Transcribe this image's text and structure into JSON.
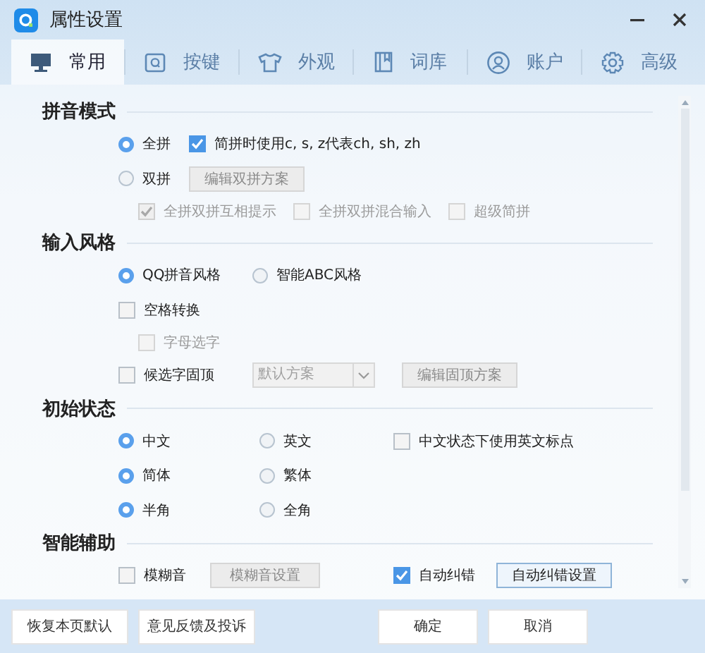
{
  "window": {
    "title": "属性设置"
  },
  "tabs": [
    {
      "label": "常用",
      "selected": true
    },
    {
      "label": "按键",
      "selected": false
    },
    {
      "label": "外观",
      "selected": false
    },
    {
      "label": "词库",
      "selected": false
    },
    {
      "label": "账户",
      "selected": false
    },
    {
      "label": "高级",
      "selected": false
    }
  ],
  "sections": [
    {
      "title": "拼音模式",
      "rows": [
        {
          "kind": "main",
          "items": [
            {
              "kind": "radio",
              "label": "全拼",
              "selected": true,
              "disabled": false
            },
            {
              "kind": "checkbox",
              "label": "简拼时使用c, s, z代表ch, sh, zh",
              "checked": true,
              "disabled": false
            }
          ]
        },
        {
          "kind": "main",
          "items": [
            {
              "kind": "radio",
              "label": "双拼",
              "selected": false,
              "disabled": false
            },
            {
              "kind": "button",
              "label": "编辑双拼方案",
              "disabled": true
            }
          ]
        },
        {
          "kind": "sub",
          "items": [
            {
              "kind": "checkbox",
              "label": "全拼双拼互相提示",
              "checked": true,
              "disabled": true
            },
            {
              "kind": "checkbox",
              "label": "全拼双拼混合输入",
              "checked": false,
              "disabled": true
            },
            {
              "kind": "checkbox",
              "label": "超级简拼",
              "checked": false,
              "disabled": true
            }
          ]
        }
      ]
    },
    {
      "title": "输入风格",
      "rows": [
        {
          "kind": "main",
          "items": [
            {
              "kind": "radio",
              "label": "QQ拼音风格",
              "selected": true,
              "disabled": false
            },
            {
              "kind": "radio",
              "label": "智能ABC风格",
              "selected": false,
              "disabled": false
            }
          ]
        },
        {
          "kind": "main",
          "items": [
            {
              "kind": "checkbox",
              "label": "空格转换",
              "checked": false,
              "disabled": false
            }
          ]
        },
        {
          "kind": "sub",
          "items": [
            {
              "kind": "checkbox",
              "label": "字母选字",
              "checked": false,
              "disabled": true
            }
          ]
        },
        {
          "kind": "main",
          "items": [
            {
              "kind": "checkbox",
              "label": "候选字固顶",
              "checked": false,
              "disabled": false
            },
            {
              "kind": "dropdown",
              "value": "默认方案",
              "disabled": true
            },
            {
              "kind": "button",
              "label": "编辑固顶方案",
              "disabled": true
            }
          ]
        }
      ]
    },
    {
      "title": "初始状态",
      "rows": [
        {
          "kind": "main",
          "items": [
            {
              "kind": "radio",
              "label": "中文",
              "selected": true,
              "disabled": false
            },
            {
              "kind": "radio",
              "label": "英文",
              "selected": false,
              "disabled": false
            },
            {
              "kind": "checkbox",
              "label": "中文状态下使用英文标点",
              "checked": false,
              "disabled": false
            }
          ]
        },
        {
          "kind": "main",
          "items": [
            {
              "kind": "radio",
              "label": "简体",
              "selected": true,
              "disabled": false
            },
            {
              "kind": "radio",
              "label": "繁体",
              "selected": false,
              "disabled": false
            }
          ]
        },
        {
          "kind": "main",
          "items": [
            {
              "kind": "radio",
              "label": "半角",
              "selected": true,
              "disabled": false
            },
            {
              "kind": "radio",
              "label": "全角",
              "selected": false,
              "disabled": false
            }
          ]
        }
      ]
    },
    {
      "title": "智能辅助",
      "rows": [
        {
          "kind": "main",
          "items": [
            {
              "kind": "checkbox",
              "label": "模糊音",
              "checked": false,
              "disabled": false
            },
            {
              "kind": "button",
              "label": "模糊音设置",
              "disabled": true
            },
            {
              "kind": "checkbox",
              "label": "自动纠错",
              "checked": true,
              "disabled": false
            },
            {
              "kind": "button",
              "label": "自动纠错设置",
              "disabled": false
            }
          ]
        }
      ]
    }
  ],
  "footer": {
    "left_buttons": [
      "恢复本页默认",
      "意见反馈及投诉"
    ],
    "right_buttons": [
      "确定",
      "取消"
    ]
  }
}
